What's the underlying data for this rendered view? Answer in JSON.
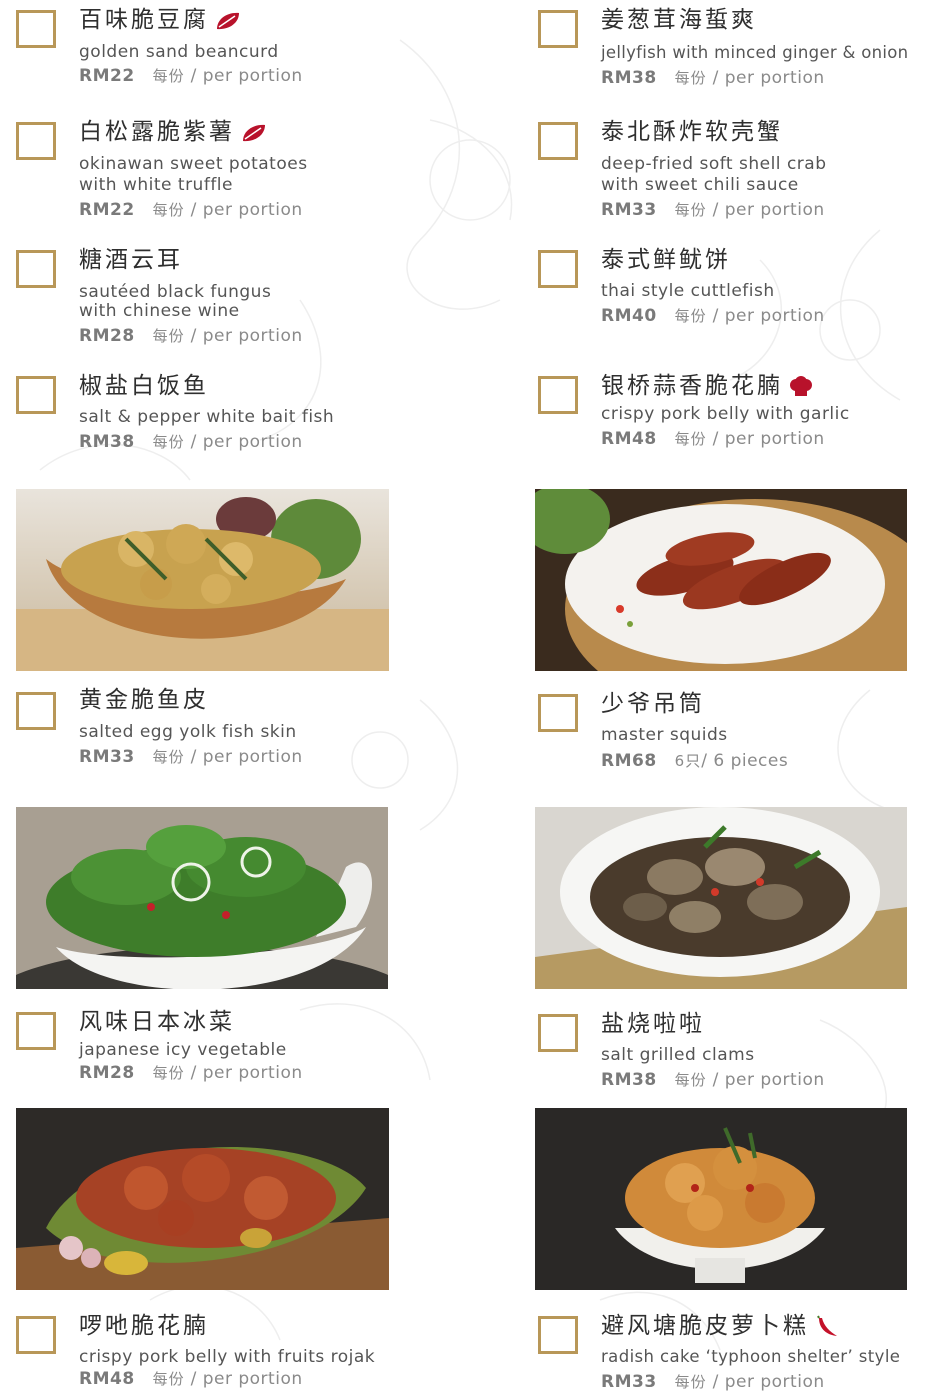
{
  "colors": {
    "checkbox_border": "#b89758",
    "leaf_icon": "#b8122b",
    "chef_icon": "#b8122b",
    "chili_icon": "#c4122a"
  },
  "items": [
    {
      "zh": "百味脆豆腐",
      "en1": "golden sand beancurd",
      "en2": "",
      "rm": "RM22",
      "pz": "每份",
      "pe": "/ per portion",
      "icon": "leaf-icon"
    },
    {
      "zh": "白松露脆紫薯",
      "en1": "okinawan sweet potatoes",
      "en2": "with white truffle",
      "rm": "RM22",
      "pz": "每份",
      "pe": "/ per portion",
      "icon": "leaf-icon"
    },
    {
      "zh": "糖酒云耳",
      "en1": "sautéed black fungus",
      "en2": "with chinese wine",
      "rm": "RM28",
      "pz": "每份",
      "pe": "/ per portion",
      "icon": ""
    },
    {
      "zh": "椒盐白饭鱼",
      "en1": "salt & pepper white bait fish",
      "en2": "",
      "rm": "RM38",
      "pz": "每份",
      "pe": "/ per portion",
      "icon": ""
    },
    {
      "zh": "黄金脆鱼皮",
      "en1": "salted egg yolk fish skin",
      "en2": "",
      "rm": "RM33",
      "pz": "每份",
      "pe": "/ per portion",
      "icon": ""
    },
    {
      "zh": "风味日本冰菜",
      "en1": "japanese icy vegetable",
      "en2": "",
      "rm": "RM28",
      "pz": "每份",
      "pe": "/ per portion",
      "icon": ""
    },
    {
      "zh": "啰吔脆花腩",
      "en1": "crispy pork belly with fruits rojak",
      "en2": "",
      "rm": "RM48",
      "pz": "每份",
      "pe": "/ per portion",
      "icon": ""
    },
    {
      "zh": "姜葱茸海蜇爽",
      "en1": "jellyfish with minced ginger & onion",
      "en2": "",
      "rm": "RM38",
      "pz": "每份",
      "pe": "/ per portion",
      "icon": ""
    },
    {
      "zh": "泰北酥炸软壳蟹",
      "en1": "deep-fried soft shell crab",
      "en2": "with sweet chili sauce",
      "rm": "RM33",
      "pz": "每份",
      "pe": "/ per portion",
      "icon": ""
    },
    {
      "zh": "泰式鲜鱿饼",
      "en1": "thai style cuttlefish",
      "en2": "",
      "rm": "RM40",
      "pz": "每份",
      "pe": "/ per portion",
      "icon": ""
    },
    {
      "zh": "银桥蒜香脆花腩",
      "en1": "crispy pork belly with garlic",
      "en2": "",
      "rm": "RM48",
      "pz": "每份",
      "pe": "/ per portion",
      "icon": "chef-hat-icon"
    },
    {
      "zh": "少爷吊筒",
      "en1": "master squids",
      "en2": "",
      "rm": "RM68",
      "pz": "6只",
      "pe": "/ 6 pieces",
      "icon": ""
    },
    {
      "zh": "盐烧啦啦",
      "en1": "salt grilled clams",
      "en2": "",
      "rm": "RM38",
      "pz": "每份",
      "pe": "/ per portion",
      "icon": ""
    },
    {
      "zh": "避风塘脆皮萝卜糕",
      "en1": "radish cake ‘typhoon shelter’ style",
      "en2": "",
      "rm": "RM33",
      "pz": "每份",
      "pe": "/ per portion",
      "icon": "chili-icon"
    }
  ]
}
